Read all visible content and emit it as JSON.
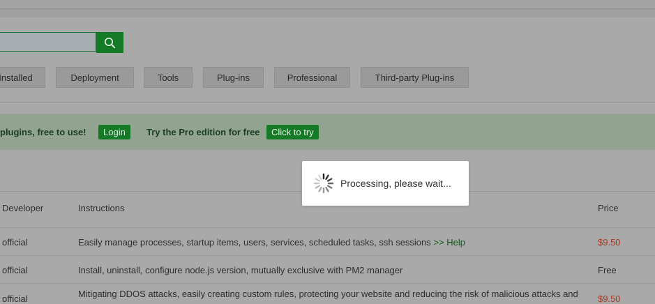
{
  "search": {
    "value": "",
    "placeholder": ""
  },
  "tabs": [
    "Installed",
    "Deployment",
    "Tools",
    "Plug-ins",
    "Professional",
    "Third-party Plug-ins"
  ],
  "banner": {
    "text1": "plugins, free to use!",
    "login_label": "Login",
    "text2": "Try the Pro edition for free",
    "try_label": "Click to try"
  },
  "table": {
    "headers": {
      "developer": "Developer",
      "instructions": "Instructions",
      "price": "Price"
    },
    "rows": [
      {
        "developer": "official",
        "instructions": "Easily manage processes, startup items, users, services, scheduled tasks, ssh sessions",
        "help": ">> Help",
        "price": "$9.50"
      },
      {
        "developer": "official",
        "instructions": "Install, uninstall, configure node.js version, mutually exclusive with PM2 manager",
        "help": "",
        "price": "Free"
      },
      {
        "developer": "official",
        "instructions": "Mitigating DDOS attacks, easily creating custom rules, protecting your website and reducing the risk of malicious attacks and",
        "help": "",
        "price": "$9.50"
      }
    ]
  },
  "loading": {
    "text": "Processing, please wait..."
  },
  "colors": {
    "accent": "#147a25",
    "price_paid": "#a63a22"
  }
}
